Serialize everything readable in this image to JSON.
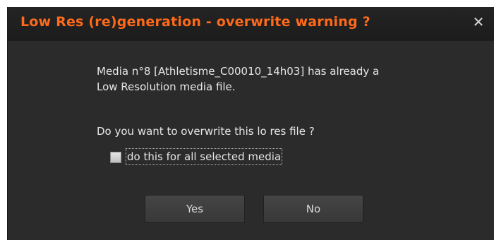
{
  "dialog": {
    "title": "Low Res (re)generation - overwrite warning ?",
    "close_symbol": "✕",
    "message_line1": "Media n°8 [Athletisme_C00010_14h03] has already a",
    "message_line2": "Low Resolution media file.",
    "question": "Do you want to overwrite this lo res file ?",
    "checkbox_label": "do this for all selected media",
    "checkbox_checked": false,
    "yes_label": "Yes",
    "no_label": "No"
  },
  "colors": {
    "title": "#ff6a1a",
    "background": "#2b2b2b",
    "titlebar": "#1e1e1e",
    "text": "#e6e6e6"
  },
  "icons": {
    "close": "close-icon"
  }
}
